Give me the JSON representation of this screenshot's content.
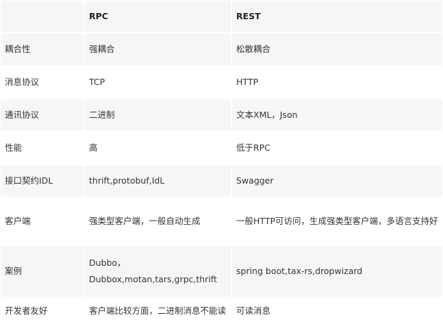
{
  "table": {
    "headers": [
      "",
      "RPC",
      "REST"
    ],
    "rows": [
      [
        "耦合性",
        "强耦合",
        "松散耦合"
      ],
      [
        "消息协议",
        "TCP",
        "HTTP"
      ],
      [
        "通讯协议",
        "二进制",
        "文本XML，Json"
      ],
      [
        "性能",
        "高",
        "低于RPC"
      ],
      [
        "接口契约IDL",
        "thrift,protobuf,IdL",
        "Swagger"
      ],
      [
        "客户端",
        "强类型客户端，一般自动生成",
        "一般HTTP可访问，生成强类型客户端，多语言支持好"
      ],
      [
        "案例",
        "Dubbo，Dubbox,motan,tars,grpc,thrift",
        "spring boot,tax-rs,dropwizard"
      ],
      [
        "开发者友好",
        "客户端比较方面，二进制消息不能读",
        "可读消息"
      ]
    ]
  }
}
